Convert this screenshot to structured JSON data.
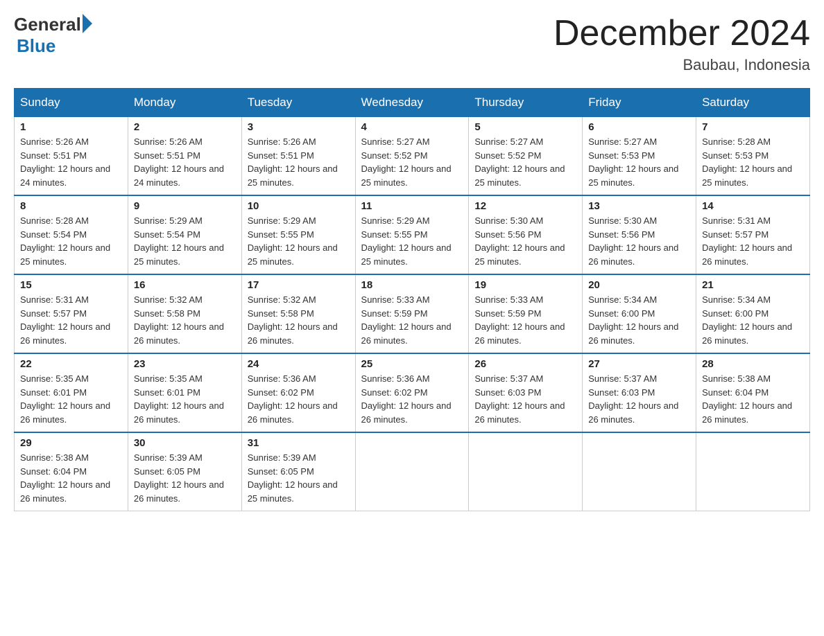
{
  "logo": {
    "general": "General",
    "blue": "Blue"
  },
  "title": "December 2024",
  "location": "Baubau, Indonesia",
  "days_of_week": [
    "Sunday",
    "Monday",
    "Tuesday",
    "Wednesday",
    "Thursday",
    "Friday",
    "Saturday"
  ],
  "weeks": [
    [
      {
        "day": "1",
        "sunrise": "5:26 AM",
        "sunset": "5:51 PM",
        "daylight": "12 hours and 24 minutes."
      },
      {
        "day": "2",
        "sunrise": "5:26 AM",
        "sunset": "5:51 PM",
        "daylight": "12 hours and 24 minutes."
      },
      {
        "day": "3",
        "sunrise": "5:26 AM",
        "sunset": "5:51 PM",
        "daylight": "12 hours and 25 minutes."
      },
      {
        "day": "4",
        "sunrise": "5:27 AM",
        "sunset": "5:52 PM",
        "daylight": "12 hours and 25 minutes."
      },
      {
        "day": "5",
        "sunrise": "5:27 AM",
        "sunset": "5:52 PM",
        "daylight": "12 hours and 25 minutes."
      },
      {
        "day": "6",
        "sunrise": "5:27 AM",
        "sunset": "5:53 PM",
        "daylight": "12 hours and 25 minutes."
      },
      {
        "day": "7",
        "sunrise": "5:28 AM",
        "sunset": "5:53 PM",
        "daylight": "12 hours and 25 minutes."
      }
    ],
    [
      {
        "day": "8",
        "sunrise": "5:28 AM",
        "sunset": "5:54 PM",
        "daylight": "12 hours and 25 minutes."
      },
      {
        "day": "9",
        "sunrise": "5:29 AM",
        "sunset": "5:54 PM",
        "daylight": "12 hours and 25 minutes."
      },
      {
        "day": "10",
        "sunrise": "5:29 AM",
        "sunset": "5:55 PM",
        "daylight": "12 hours and 25 minutes."
      },
      {
        "day": "11",
        "sunrise": "5:29 AM",
        "sunset": "5:55 PM",
        "daylight": "12 hours and 25 minutes."
      },
      {
        "day": "12",
        "sunrise": "5:30 AM",
        "sunset": "5:56 PM",
        "daylight": "12 hours and 25 minutes."
      },
      {
        "day": "13",
        "sunrise": "5:30 AM",
        "sunset": "5:56 PM",
        "daylight": "12 hours and 26 minutes."
      },
      {
        "day": "14",
        "sunrise": "5:31 AM",
        "sunset": "5:57 PM",
        "daylight": "12 hours and 26 minutes."
      }
    ],
    [
      {
        "day": "15",
        "sunrise": "5:31 AM",
        "sunset": "5:57 PM",
        "daylight": "12 hours and 26 minutes."
      },
      {
        "day": "16",
        "sunrise": "5:32 AM",
        "sunset": "5:58 PM",
        "daylight": "12 hours and 26 minutes."
      },
      {
        "day": "17",
        "sunrise": "5:32 AM",
        "sunset": "5:58 PM",
        "daylight": "12 hours and 26 minutes."
      },
      {
        "day": "18",
        "sunrise": "5:33 AM",
        "sunset": "5:59 PM",
        "daylight": "12 hours and 26 minutes."
      },
      {
        "day": "19",
        "sunrise": "5:33 AM",
        "sunset": "5:59 PM",
        "daylight": "12 hours and 26 minutes."
      },
      {
        "day": "20",
        "sunrise": "5:34 AM",
        "sunset": "6:00 PM",
        "daylight": "12 hours and 26 minutes."
      },
      {
        "day": "21",
        "sunrise": "5:34 AM",
        "sunset": "6:00 PM",
        "daylight": "12 hours and 26 minutes."
      }
    ],
    [
      {
        "day": "22",
        "sunrise": "5:35 AM",
        "sunset": "6:01 PM",
        "daylight": "12 hours and 26 minutes."
      },
      {
        "day": "23",
        "sunrise": "5:35 AM",
        "sunset": "6:01 PM",
        "daylight": "12 hours and 26 minutes."
      },
      {
        "day": "24",
        "sunrise": "5:36 AM",
        "sunset": "6:02 PM",
        "daylight": "12 hours and 26 minutes."
      },
      {
        "day": "25",
        "sunrise": "5:36 AM",
        "sunset": "6:02 PM",
        "daylight": "12 hours and 26 minutes."
      },
      {
        "day": "26",
        "sunrise": "5:37 AM",
        "sunset": "6:03 PM",
        "daylight": "12 hours and 26 minutes."
      },
      {
        "day": "27",
        "sunrise": "5:37 AM",
        "sunset": "6:03 PM",
        "daylight": "12 hours and 26 minutes."
      },
      {
        "day": "28",
        "sunrise": "5:38 AM",
        "sunset": "6:04 PM",
        "daylight": "12 hours and 26 minutes."
      }
    ],
    [
      {
        "day": "29",
        "sunrise": "5:38 AM",
        "sunset": "6:04 PM",
        "daylight": "12 hours and 26 minutes."
      },
      {
        "day": "30",
        "sunrise": "5:39 AM",
        "sunset": "6:05 PM",
        "daylight": "12 hours and 26 minutes."
      },
      {
        "day": "31",
        "sunrise": "5:39 AM",
        "sunset": "6:05 PM",
        "daylight": "12 hours and 25 minutes."
      },
      null,
      null,
      null,
      null
    ]
  ]
}
